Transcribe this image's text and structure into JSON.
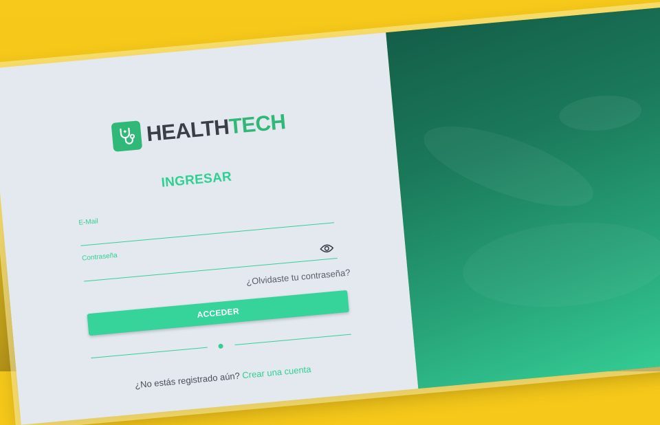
{
  "brand": {
    "name_part1": "HEALTH",
    "name_part2": "TECH"
  },
  "login": {
    "title": "INGRESAR",
    "email_label": "E-Mail",
    "email_value": "",
    "password_label": "Contraseña",
    "password_value": "",
    "forgot_link": "¿Olvidaste tu contraseña?",
    "submit_label": "ACCEDER",
    "signup_prompt": "¿No estás registrado aún?",
    "signup_link": "Crear una cuenta"
  },
  "colors": {
    "accent": "#35cf96",
    "brand_green": "#2fb877",
    "panel_bg": "#e4e8ef",
    "background": "#f6c91a"
  },
  "icons": {
    "logo": "stethoscope-icon",
    "password_toggle": "eye-icon"
  }
}
